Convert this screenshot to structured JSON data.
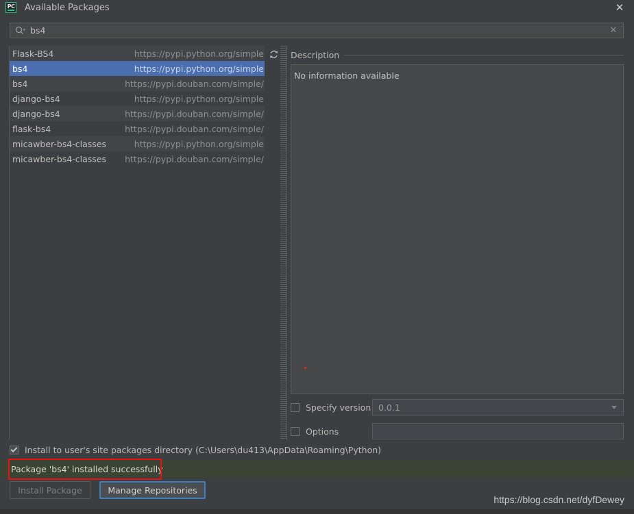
{
  "window": {
    "title": "Available Packages",
    "app_icon": "pycharm-icon",
    "close_icon": "close-icon"
  },
  "search": {
    "icon": "search-icon",
    "value": "bs4",
    "placeholder": "",
    "clear_icon": "clear-icon"
  },
  "toolbar": {
    "refresh_icon": "refresh-icon"
  },
  "packages": [
    {
      "name": "Flask-BS4",
      "url": "https://pypi.python.org/simple",
      "selected": false
    },
    {
      "name": "bs4",
      "url": "https://pypi.python.org/simple",
      "selected": true
    },
    {
      "name": "bs4",
      "url": "https://pypi.douban.com/simple/",
      "selected": false
    },
    {
      "name": "django-bs4",
      "url": "https://pypi.python.org/simple",
      "selected": false
    },
    {
      "name": "django-bs4",
      "url": "https://pypi.douban.com/simple/",
      "selected": false
    },
    {
      "name": "flask-bs4",
      "url": "https://pypi.douban.com/simple/",
      "selected": false
    },
    {
      "name": "micawber-bs4-classes",
      "url": "https://pypi.python.org/simple",
      "selected": false
    },
    {
      "name": "micawber-bs4-classes",
      "url": "https://pypi.douban.com/simple/",
      "selected": false
    }
  ],
  "description": {
    "header": "Description",
    "body": "No information available"
  },
  "version_row": {
    "label": "Specify version",
    "checked": false,
    "value": "0.0.1",
    "dropdown_icon": "chevron-down-icon"
  },
  "options_row": {
    "label": "Options",
    "checked": false,
    "value": ""
  },
  "install_dir": {
    "label": "Install to user's site packages directory (C:\\Users\\du413\\AppData\\Roaming\\Python)",
    "checked": true
  },
  "status": {
    "message": "Package 'bs4' installed successfully",
    "banner_color": "#3a4434",
    "annotation_color": "#ef0f0f"
  },
  "buttons": {
    "install": "Install Package",
    "manage": "Manage Repositories"
  },
  "watermark": "https://blog.csdn.net/dyfDewey"
}
